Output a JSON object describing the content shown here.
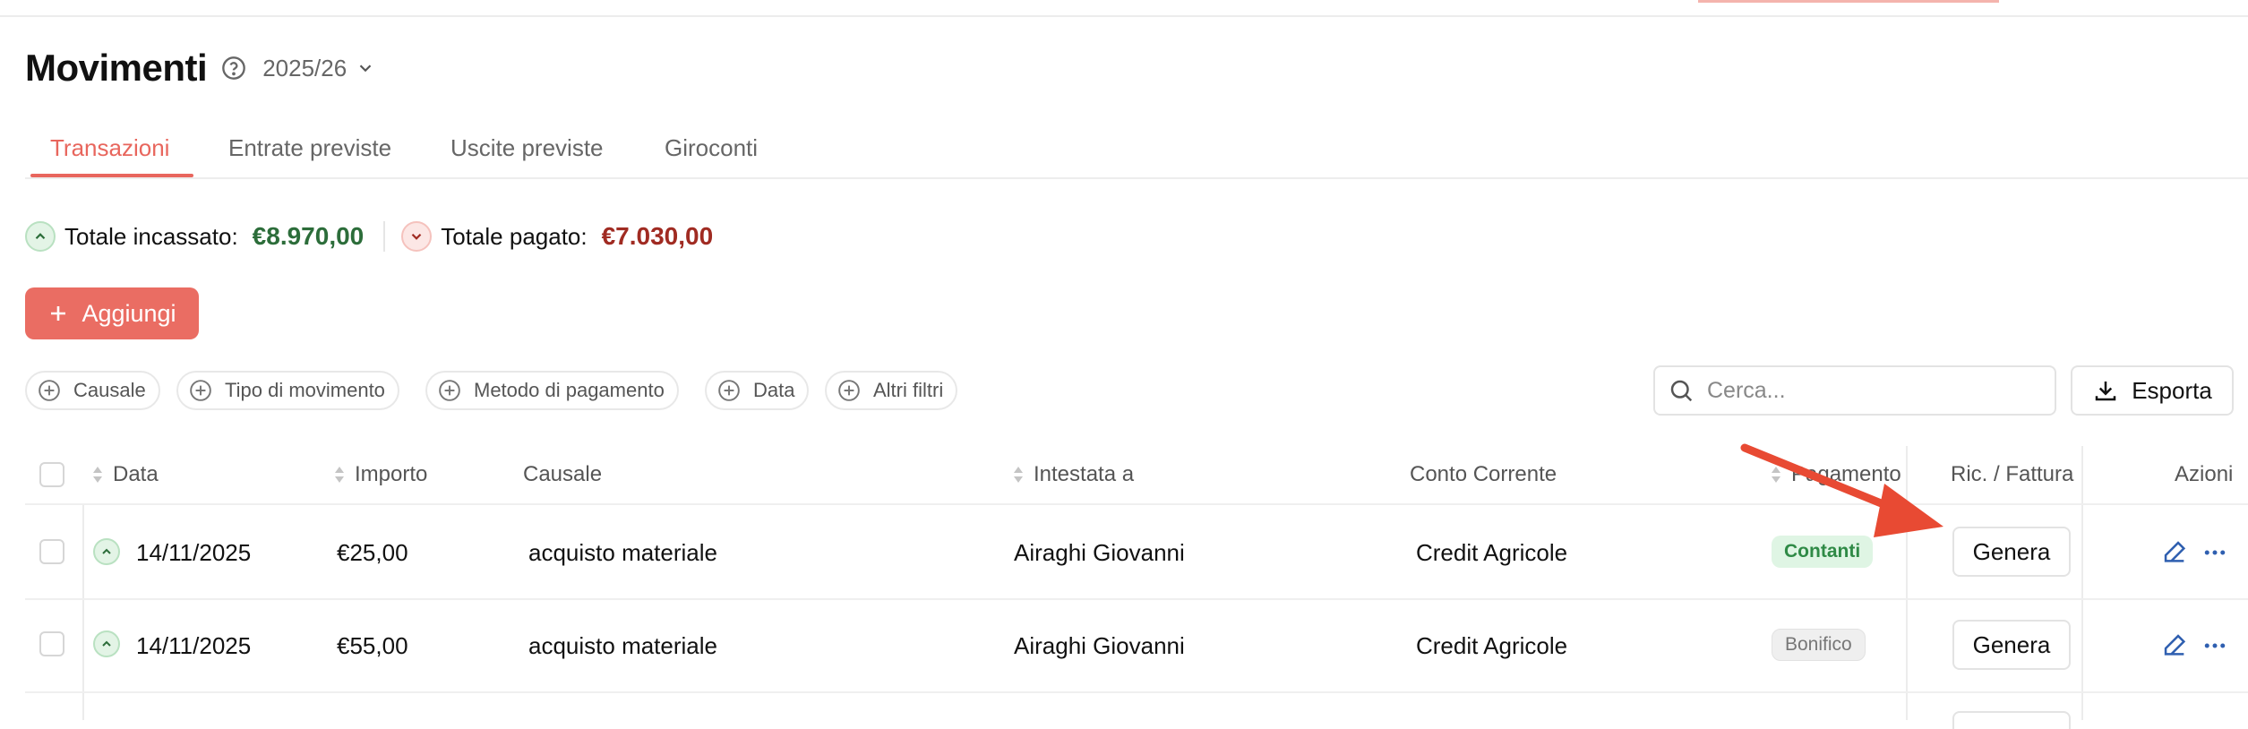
{
  "header": {
    "title": "Movimenti",
    "year": "2025/26"
  },
  "tabs": [
    {
      "label": "Transazioni",
      "active": true
    },
    {
      "label": "Entrate previste"
    },
    {
      "label": "Uscite previste"
    },
    {
      "label": "Giroconti"
    }
  ],
  "totals": {
    "income_label": "Totale incassato:",
    "income_value": "€8.970,00",
    "expense_label": "Totale pagato:",
    "expense_value": "€7.030,00"
  },
  "add_button": {
    "label": "Aggiungi"
  },
  "filters": [
    "Causale",
    "Tipo di movimento",
    "Metodo di pagamento",
    "Data",
    "Altri filtri"
  ],
  "search": {
    "placeholder": "Cerca..."
  },
  "export_button": {
    "label": "Esporta"
  },
  "table": {
    "columns": [
      "Data",
      "Importo",
      "Causale",
      "Intestata a",
      "Conto Corrente",
      "Pagamento",
      "Ric. / Fattura",
      "Azioni"
    ],
    "rows": [
      {
        "date": "14/11/2025",
        "amount": "€25,00",
        "reason": "acquisto materiale",
        "holder": "Airaghi Giovanni",
        "account": "Credit Agricole",
        "payment": "Contanti",
        "invoice_action": "Genera"
      },
      {
        "date": "14/11/2025",
        "amount": "€55,00",
        "reason": "acquisto materiale",
        "holder": "Airaghi Giovanni",
        "account": "Credit Agricole",
        "payment": "Bonifico",
        "invoice_action": "Genera"
      }
    ]
  },
  "colors": {
    "accent": "#e8665d",
    "income": "#2c6d3a",
    "expense": "#a02b22",
    "arrow": "#e84a33"
  }
}
